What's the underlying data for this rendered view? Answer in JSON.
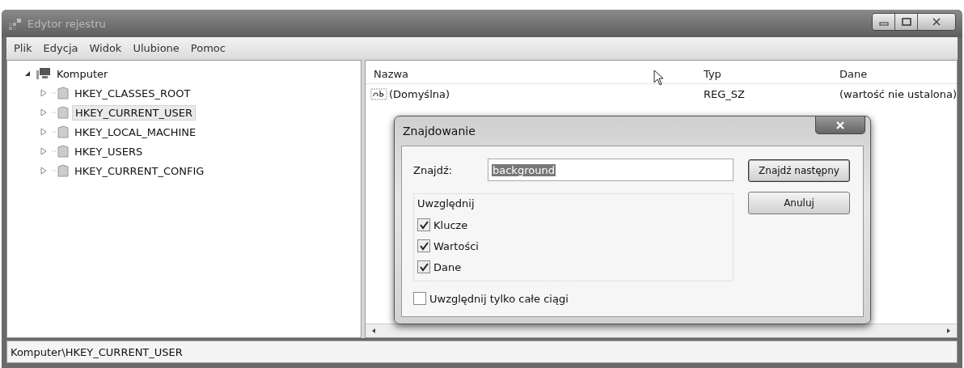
{
  "window": {
    "title": "Edytor rejestru"
  },
  "menu": [
    "Plik",
    "Edycja",
    "Widok",
    "Ulubione",
    "Pomoc"
  ],
  "tree": [
    {
      "label": "Komputer",
      "expanded": true,
      "selected": false,
      "children": [
        {
          "label": "HKEY_CLASSES_ROOT",
          "expanded": false,
          "selected": false
        },
        {
          "label": "HKEY_CURRENT_USER",
          "expanded": false,
          "selected": true
        },
        {
          "label": "HKEY_LOCAL_MACHINE",
          "expanded": false,
          "selected": false
        },
        {
          "label": "HKEY_USERS",
          "expanded": false,
          "selected": false
        },
        {
          "label": "HKEY_CURRENT_CONFIG",
          "expanded": false,
          "selected": false
        }
      ]
    }
  ],
  "values_table": {
    "columns": [
      "Nazwa",
      "Typ",
      "Dane"
    ],
    "rows": [
      {
        "name": "(Domyślna)",
        "type": "REG_SZ",
        "data": "(wartość nie ustalona)"
      }
    ]
  },
  "find_dialog": {
    "title": "Znajdowanie",
    "find_label": "Znajdź:",
    "find_value": "background",
    "value_selected": true,
    "buttons": [
      "Znajdź następny",
      "Anuluj"
    ],
    "group_label": "Uwzględnij",
    "options": [
      {
        "label": "Klucze",
        "checked": true
      },
      {
        "label": "Wartości",
        "checked": true
      },
      {
        "label": "Dane",
        "checked": true
      }
    ],
    "whole_strings": {
      "label": "Uwzględnij tylko całe ciągi",
      "checked": false
    }
  },
  "status_bar": "Komputer\\HKEY_CURRENT_USER"
}
